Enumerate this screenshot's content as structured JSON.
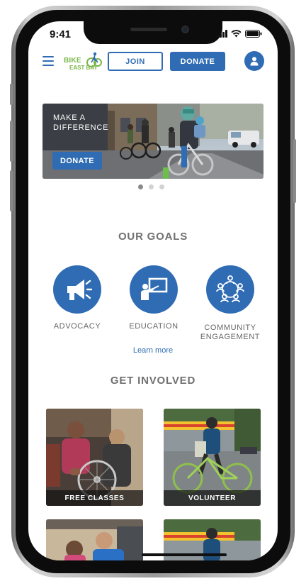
{
  "status_bar": {
    "time": "9:41"
  },
  "header": {
    "logo_line1": "BIKE",
    "logo_line2": "EAST BAY",
    "join_label": "JOIN",
    "donate_label": "DONATE"
  },
  "hero": {
    "headline": "MAKE A DIFFERENCE",
    "donate_label": "DONATE",
    "slide_count": 3,
    "active_slide": 1
  },
  "goals": {
    "title": "OUR GOALS",
    "items": [
      {
        "label": "ADVOCACY",
        "icon": "megaphone-icon"
      },
      {
        "label": "EDUCATION",
        "icon": "teacher-board-icon"
      },
      {
        "label": "COMMUNITY ENGAGEMENT",
        "icon": "community-network-icon"
      }
    ],
    "learn_more": "Learn more"
  },
  "get_involved": {
    "title": "GET INVOLVED",
    "cards": [
      {
        "label": "FREE CLASSES"
      },
      {
        "label": "VOLUNTEER"
      }
    ]
  },
  "colors": {
    "brand_blue": "#2f6cb3",
    "heading_gray": "#707070",
    "logo_green": "#7ab648"
  }
}
